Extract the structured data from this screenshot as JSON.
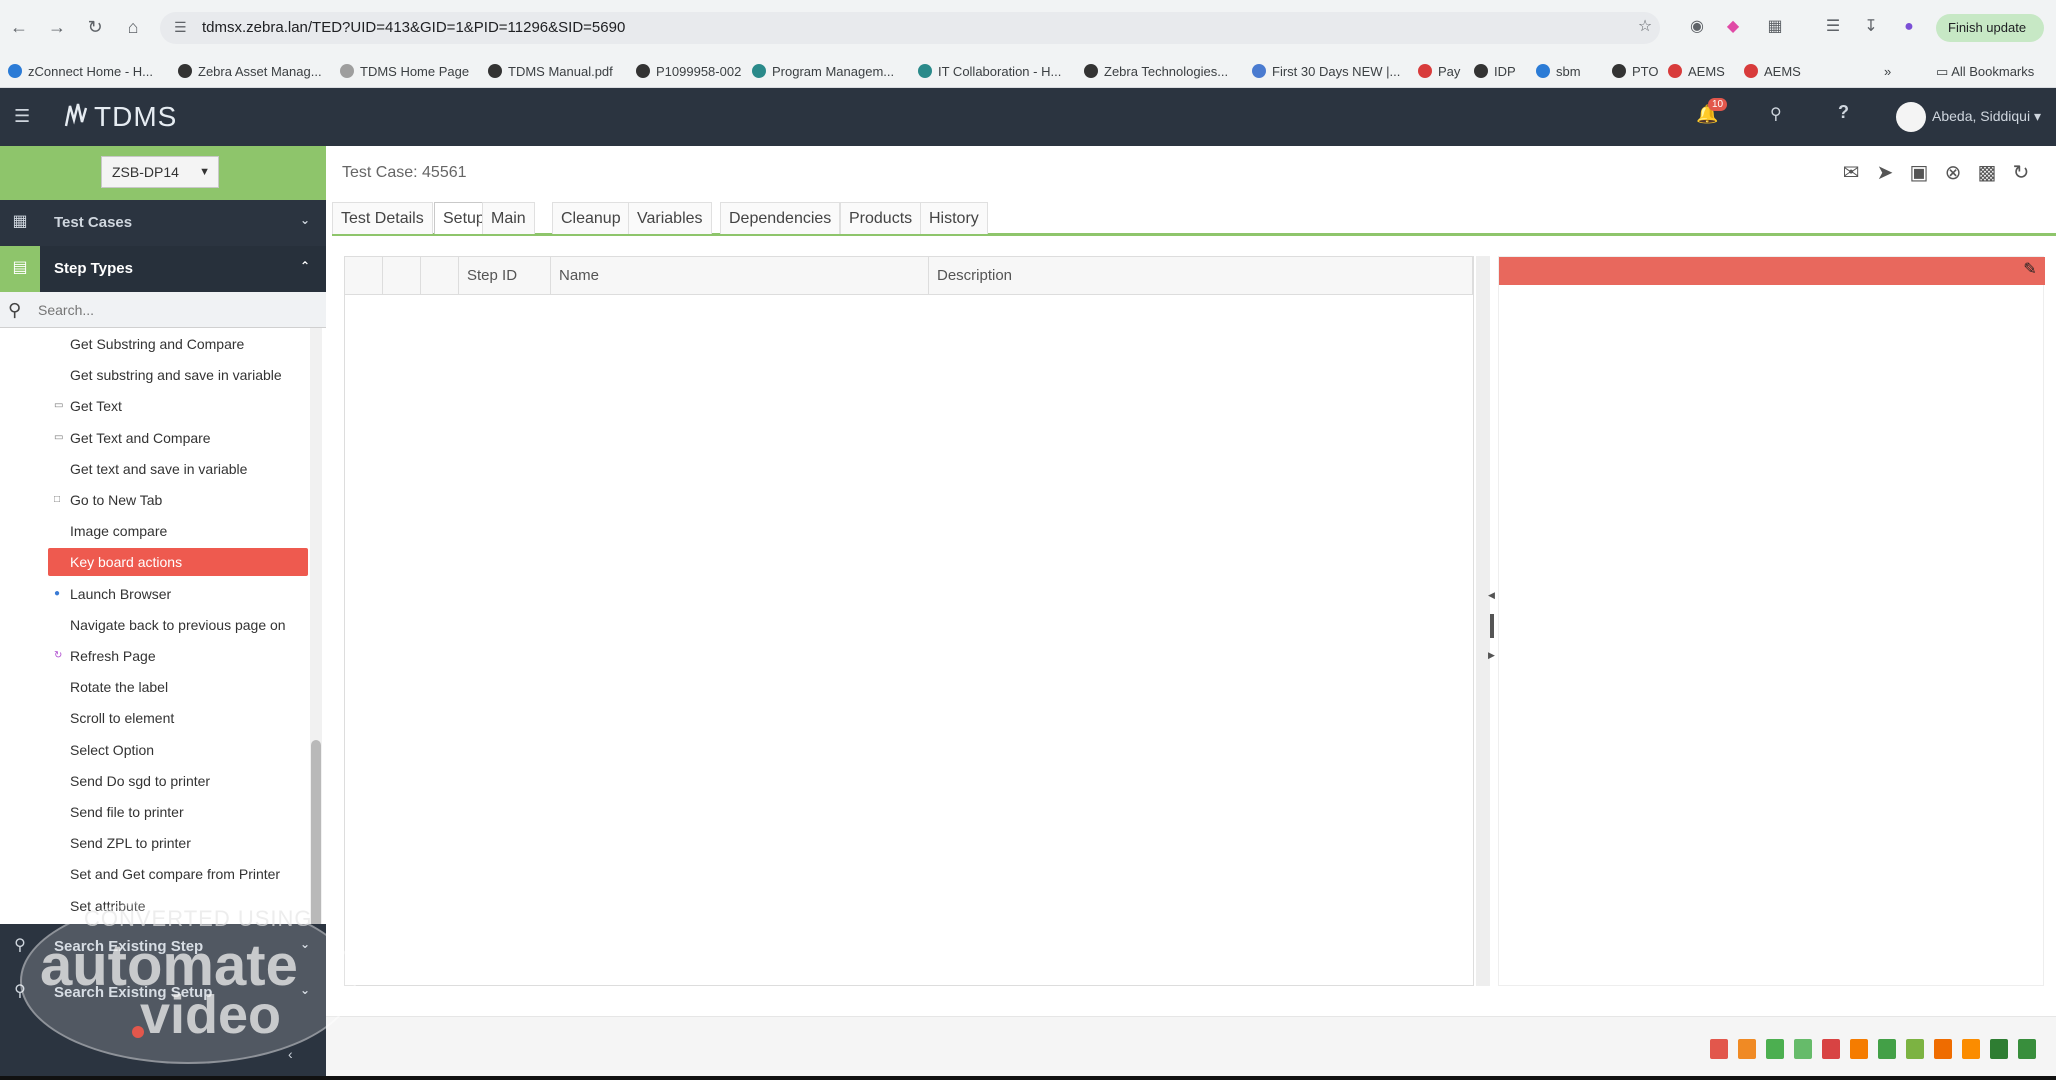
{
  "browser": {
    "url": "tdmsx.zebra.lan/TED?UID=413&GID=1&PID=11296&SID=5690",
    "finish_update": "Finish update",
    "bookmarks": [
      {
        "label": "zConnect Home - H...",
        "color": "#2b7bd6"
      },
      {
        "label": "Zebra Asset Manag...",
        "color": "#333333"
      },
      {
        "label": "TDMS Home Page",
        "color": "#9e9e9e"
      },
      {
        "label": "TDMS Manual.pdf",
        "color": "#333333"
      },
      {
        "label": "P1099958-002",
        "color": "#333333"
      },
      {
        "label": "Program Managem...",
        "color": "#2a8a8a"
      },
      {
        "label": "IT Collaboration - H...",
        "color": "#2a8a8a"
      },
      {
        "label": "Zebra Technologies...",
        "color": "#333333"
      },
      {
        "label": "First 30 Days NEW |...",
        "color": "#4a7bd0"
      },
      {
        "label": "Pay",
        "color": "#d83b3b"
      },
      {
        "label": "IDP",
        "color": "#333333"
      },
      {
        "label": "sbm",
        "color": "#2b7bd6"
      },
      {
        "label": "PTO",
        "color": "#333333"
      },
      {
        "label": "AEMS",
        "color": "#d83b3b"
      },
      {
        "label": "AEMS",
        "color": "#d83b3b"
      }
    ],
    "all_bookmarks": "All Bookmarks"
  },
  "header": {
    "logo_text": "TDMS",
    "notifications_count": "10",
    "user_name": "Abeda, Siddiqui"
  },
  "sidebar": {
    "project": "ZSB-DP14",
    "sections": {
      "test_cases": "Test Cases",
      "step_types": "Step Types",
      "search_existing_step": "Search Existing Step",
      "search_existing_setup": "Search Existing Setup"
    },
    "search_placeholder": "Search...",
    "step_items": [
      {
        "label": "Get Substring and Compare",
        "icon": ""
      },
      {
        "label": "Get substring and save in variable",
        "icon": ""
      },
      {
        "label": "Get Text",
        "icon": "text-icon"
      },
      {
        "label": "Get Text and Compare",
        "icon": "text-icon"
      },
      {
        "label": "Get text and save in variable",
        "icon": ""
      },
      {
        "label": "Go to New Tab",
        "icon": "tab-icon"
      },
      {
        "label": "Image compare",
        "icon": ""
      },
      {
        "label": "Key board actions",
        "icon": "",
        "active": true
      },
      {
        "label": "Launch Browser",
        "icon": "globe-icon"
      },
      {
        "label": "Navigate back to previous page on",
        "icon": ""
      },
      {
        "label": "Refresh Page",
        "icon": "refresh-icon"
      },
      {
        "label": "Rotate the label",
        "icon": ""
      },
      {
        "label": "Scroll to element",
        "icon": ""
      },
      {
        "label": "Select Option",
        "icon": ""
      },
      {
        "label": "Send Do sgd to printer",
        "icon": ""
      },
      {
        "label": "Send file to printer",
        "icon": ""
      },
      {
        "label": "Send ZPL to printer",
        "icon": ""
      },
      {
        "label": "Set and Get compare from Printer",
        "icon": ""
      },
      {
        "label": "Set attribute",
        "icon": ""
      }
    ]
  },
  "main": {
    "title": "Test Case: 45561",
    "tabs": [
      "Test Details",
      "Setup",
      "Main",
      "Cleanup",
      "Variables",
      "Dependencies",
      "Products",
      "History"
    ],
    "active_tab": "Setup",
    "grid_columns": [
      "",
      "",
      "",
      "Step ID",
      "Name",
      "Description"
    ],
    "accent_color": "#8ec56b",
    "highlight_color": "#ee5a4f"
  },
  "watermark": {
    "line1": "CONVERTED USING",
    "line2": "automate",
    "line3": "video"
  }
}
